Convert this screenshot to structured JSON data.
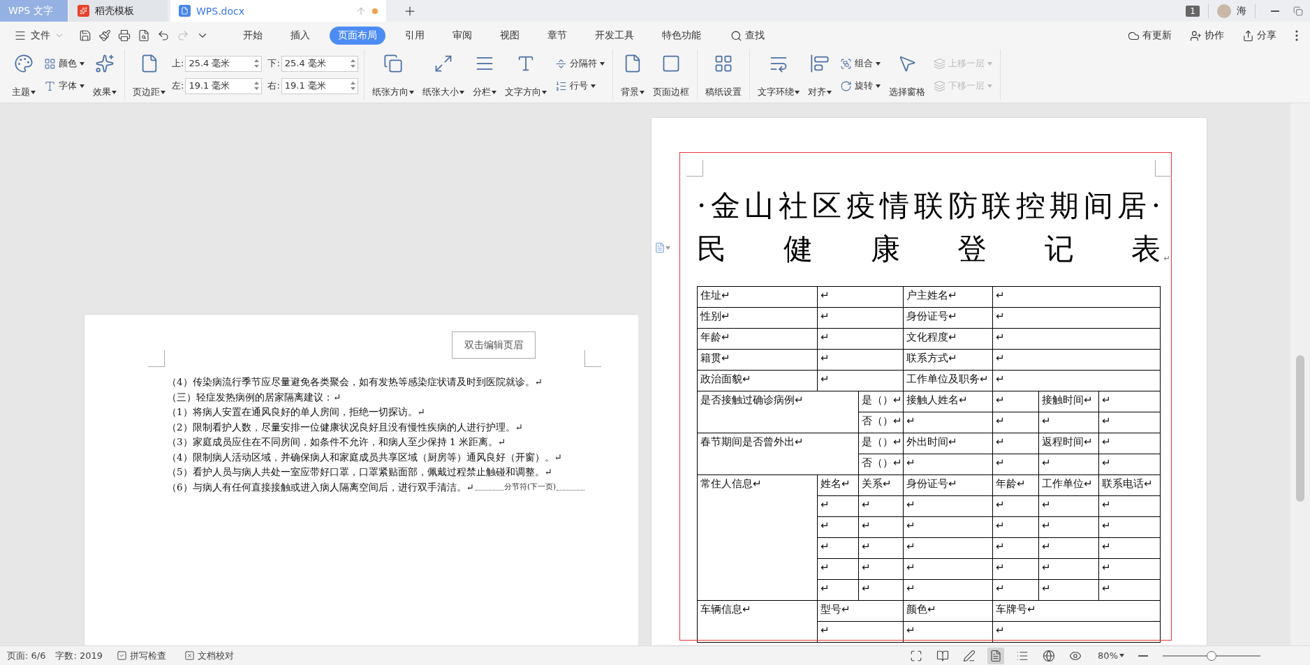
{
  "title_tabs": [
    {
      "label": "WPS 文字",
      "kind": "home",
      "selected": false
    },
    {
      "label": "稻壳模板",
      "kind": "template",
      "selected": false
    },
    {
      "label": "WPS.docx",
      "kind": "document",
      "selected": true,
      "modified": true
    }
  ],
  "account": {
    "badge": "1",
    "name": "海"
  },
  "file_menu": "文件",
  "quick_access": [
    {
      "disabled": false
    },
    {
      "disabled": false
    },
    {
      "disabled": false
    },
    {
      "disabled": false
    },
    {
      "disabled": false
    },
    {
      "disabled": true
    },
    {
      "disabled": false
    }
  ],
  "ribbon_tabs": [
    {
      "label": "开始",
      "selected": false
    },
    {
      "label": "插入",
      "selected": false
    },
    {
      "label": "页面布局",
      "selected": true
    },
    {
      "label": "引用",
      "selected": false
    },
    {
      "label": "审阅",
      "selected": false
    },
    {
      "label": "视图",
      "selected": false
    },
    {
      "label": "章节",
      "selected": false
    },
    {
      "label": "开发工具",
      "selected": false
    },
    {
      "label": "特色功能",
      "selected": false
    }
  ],
  "search": "查找",
  "actions": [
    "有更新",
    "协作",
    "分享"
  ],
  "ribbon_groups": [
    {
      "items": [
        {
          "kind": "large",
          "label": "主题",
          "dropdown": true,
          "disabled": false
        },
        {
          "kind": "stack",
          "items": [
            {
              "label": "颜色",
              "dropdown": true,
              "disabled": false
            },
            {
              "label": "字体",
              "dropdown": true,
              "disabled": false
            }
          ]
        },
        {
          "kind": "large",
          "label": "效果",
          "dropdown": true,
          "disabled": false
        }
      ]
    },
    {
      "items": [
        {
          "kind": "large",
          "label": "页边距",
          "dropdown": true,
          "disabled": false
        },
        {
          "kind": "margins",
          "fields": [
            {
              "label": "上:",
              "value": "25.4 毫米"
            },
            {
              "label": "下:",
              "value": "25.4 毫米"
            },
            {
              "label": "左:",
              "value": "19.1 毫米"
            },
            {
              "label": "右:",
              "value": "19.1 毫米"
            }
          ]
        }
      ]
    },
    {
      "items": [
        {
          "kind": "large",
          "label": "纸张方向",
          "dropdown": true,
          "disabled": false
        },
        {
          "kind": "large",
          "label": "纸张大小",
          "dropdown": true,
          "disabled": false
        },
        {
          "kind": "large",
          "label": "分栏",
          "dropdown": true,
          "disabled": false
        },
        {
          "kind": "large",
          "label": "文字方向",
          "dropdown": true,
          "disabled": false
        },
        {
          "kind": "stack",
          "items": [
            {
              "label": "分隔符",
              "dropdown": true,
              "disabled": false
            },
            {
              "label": "行号",
              "dropdown": true,
              "disabled": false
            }
          ]
        }
      ]
    },
    {
      "items": [
        {
          "kind": "large",
          "label": "背景",
          "dropdown": true,
          "disabled": false
        },
        {
          "kind": "large",
          "label": "页面边框",
          "dropdown": false,
          "disabled": false
        }
      ]
    },
    {
      "items": [
        {
          "kind": "large",
          "label": "稿纸设置",
          "dropdown": false,
          "disabled": false
        }
      ]
    },
    {
      "items": [
        {
          "kind": "large",
          "label": "文字环绕",
          "dropdown": true,
          "disabled": false
        },
        {
          "kind": "large",
          "label": "对齐",
          "dropdown": true,
          "disabled": false
        },
        {
          "kind": "stack",
          "items": [
            {
              "label": "组合",
              "dropdown": true,
              "disabled": false
            },
            {
              "label": "旋转",
              "dropdown": true,
              "disabled": false
            }
          ]
        },
        {
          "kind": "large",
          "label": "选择窗格",
          "dropdown": false,
          "disabled": false
        },
        {
          "kind": "stack",
          "items": [
            {
              "label": "上移一层",
              "dropdown": true,
              "disabled": true
            },
            {
              "label": "下移一层",
              "dropdown": true,
              "disabled": true
            }
          ]
        }
      ]
    }
  ],
  "left_page": {
    "header_button": "双击编辑页眉",
    "lines": [
      "（4）传染病流行季节应尽量避免各类聚会，如有发热等感染症状请及时到医院就诊。↵",
      "（三）轻症发热病例的居家隔离建议：↵",
      "（1）将病人安置在通风良好的单人房间，拒绝一切探访。↵",
      "（2）限制看护人数，尽量安排一位健康状况良好且没有慢性疾病的人进行护理。↵",
      "（3）家庭成员应住在不同房间，如条件不允许，和病人至少保持 1 米距离。↵",
      "（4）限制病人活动区域，并确保病人和家庭成员共享区域（厨房等）通风良好（开窗）。↵",
      "（5）看护人员与病人共处一室应带好口罩，口罩紧贴面部，佩戴过程禁止触碰和调整。↵",
      "（6）与病人有任何直接接触或进入病人隔离空间后，进行双手清洁。↵"
    ],
    "section_break": "分节符(下一页)"
  },
  "right_page": {
    "title_lines": [
      "·金山社区疫情联防联控期间居·",
      "民健康登记表"
    ],
    "title_end_mark": "↵",
    "table": {
      "info_rows": [
        {
          "label": "住址↵",
          "value": "↵",
          "label_2": "户主姓名↵",
          "value_2": "↵"
        },
        {
          "label": "性别↵",
          "value": "↵",
          "label_2": "身份证号↵",
          "value_2": "↵"
        },
        {
          "label": "年龄↵",
          "value": "↵",
          "label_2": "文化程度↵",
          "value_2": "↵"
        },
        {
          "label": "籍贯↵",
          "value": "↵",
          "label_2": "联系方式↵",
          "value_2": "↵"
        },
        {
          "label": "政治面貌↵",
          "value": "↵",
          "label_2": "工作单位及职务↵",
          "value_2": "↵"
        }
      ],
      "yes_no_rows": [
        {
          "question": "是否接触过确诊病例↵",
          "options": [
            {
              "label": "是（）↵",
              "cells": [
                "接触人姓名↵",
                "↵",
                "接触时间↵",
                "↵"
              ]
            },
            {
              "label": "否（）↵",
              "cells": [
                "↵",
                "↵",
                "↵",
                "↵"
              ]
            }
          ]
        },
        {
          "question": "春节期间是否曾外出↵",
          "options": [
            {
              "label": "是（）↵",
              "cells": [
                "外出时间↵",
                "↵",
                "返程时间↵",
                "↵"
              ]
            },
            {
              "label": "否（）↵",
              "cells": [
                "↵",
                "↵",
                "↵",
                "↵"
              ]
            }
          ]
        }
      ],
      "residents": {
        "label": "常住人信息↵",
        "header": [
          "姓名↵",
          "关系↵",
          "身份证号↵",
          "年龄↵",
          "工作单位↵",
          "联系电话↵"
        ],
        "rows": [
          [
            "↵",
            "↵",
            "↵",
            "↵",
            "↵",
            "↵"
          ],
          [
            "↵",
            "↵",
            "↵",
            "↵",
            "↵",
            "↵"
          ],
          [
            "↵",
            "↵",
            "↵",
            "↵",
            "↵",
            "↵"
          ],
          [
            "↵",
            "↵",
            "↵",
            "↵",
            "↵",
            "↵"
          ],
          [
            "↵",
            "↵",
            "↵",
            "↵",
            "↵",
            "↵"
          ]
        ]
      },
      "vehicle": {
        "label": "车辆信息↵",
        "header": [
          "型号↵",
          "颜色↵",
          "车牌号↵"
        ],
        "rows": [
          [
            "↵",
            "↵",
            "↵"
          ]
        ]
      }
    }
  },
  "status_bar": {
    "page": "页面: 6/6",
    "words": "字数: 2019",
    "tools": [
      "拼写检查",
      "文档校对"
    ],
    "views": [
      {
        "selected": false
      },
      {
        "selected": false
      },
      {
        "selected": false
      },
      {
        "selected": true
      },
      {
        "selected": false
      },
      {
        "selected": false
      },
      {
        "selected": false
      }
    ],
    "zoom": "80%",
    "zoom_slider": {
      "level": 0.5
    }
  }
}
